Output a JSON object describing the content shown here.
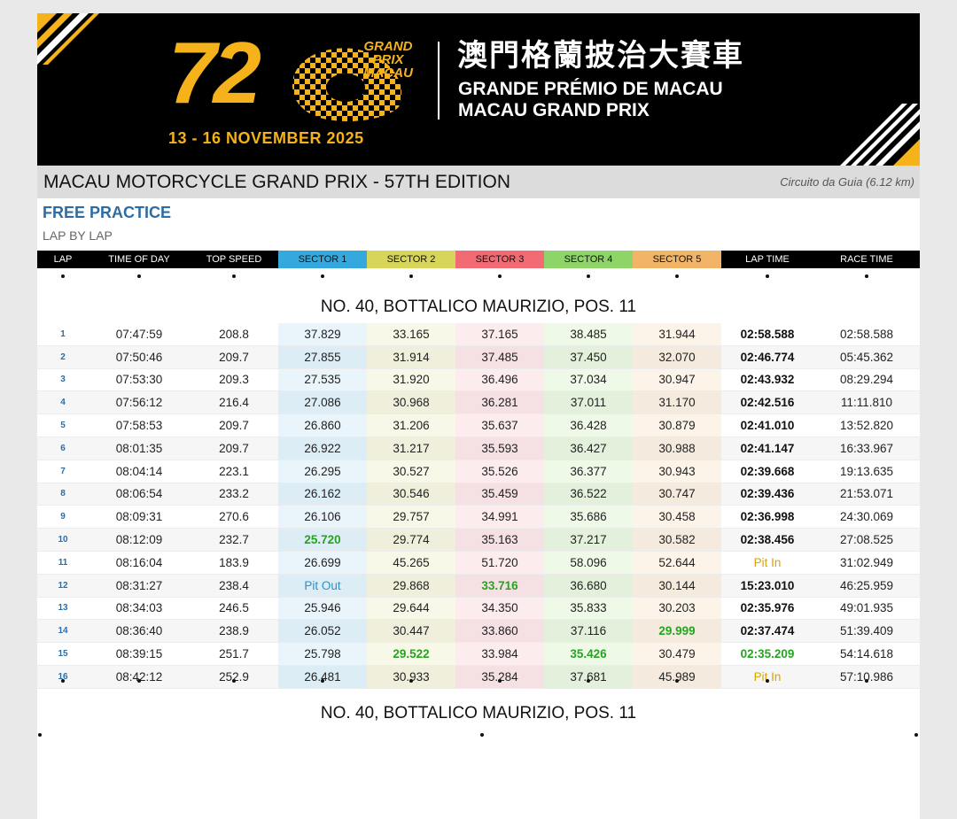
{
  "banner": {
    "edition_number": "72",
    "logo_text": [
      "GRAND",
      "PRIX",
      "MACAU"
    ],
    "title_cn": "澳門格蘭披治大賽車",
    "title_pt": "GRANDE PRÉMIO DE MACAU",
    "title_en": "MACAU GRAND PRIX",
    "dates": "13 - 16 NOVEMBER 2025",
    "brand_color": "#f5b21a"
  },
  "event": {
    "title": "MACAU MOTORCYCLE GRAND PRIX - 57TH EDITION",
    "circuit": "Circuito da Guia (6.12 km)"
  },
  "session": "FREE PRACTICE",
  "report": "LAP BY LAP",
  "columns": [
    "LAP",
    "TIME OF DAY",
    "TOP SPEED",
    "SECTOR 1",
    "SECTOR 2",
    "SECTOR 3",
    "SECTOR 4",
    "SECTOR 5",
    "LAP TIME",
    "RACE TIME"
  ],
  "driver_heading": "NO. 40, BOTTALICO MAURIZIO, POS. 11",
  "driver_heading_repeat": "NO. 40, BOTTALICO MAURIZIO, POS. 11",
  "status_colors": {
    "best": "#27a322",
    "pit_in": "#d9a400",
    "pit_out": "#2e8fc9"
  },
  "laps": [
    {
      "lap": "1",
      "tod": "07:47:59",
      "speed": "208.8",
      "s1": "37.829",
      "s2": "33.165",
      "s3": "37.165",
      "s4": "38.485",
      "s5": "31.944",
      "lap_time": "02:58.588",
      "race_time": "02:58.588"
    },
    {
      "lap": "2",
      "tod": "07:50:46",
      "speed": "209.7",
      "s1": "27.855",
      "s2": "31.914",
      "s3": "37.485",
      "s4": "37.450",
      "s5": "32.070",
      "lap_time": "02:46.774",
      "race_time": "05:45.362"
    },
    {
      "lap": "3",
      "tod": "07:53:30",
      "speed": "209.3",
      "s1": "27.535",
      "s2": "31.920",
      "s3": "36.496",
      "s4": "37.034",
      "s5": "30.947",
      "lap_time": "02:43.932",
      "race_time": "08:29.294"
    },
    {
      "lap": "4",
      "tod": "07:56:12",
      "speed": "216.4",
      "s1": "27.086",
      "s2": "30.968",
      "s3": "36.281",
      "s4": "37.011",
      "s5": "31.170",
      "lap_time": "02:42.516",
      "race_time": "11:11.810"
    },
    {
      "lap": "5",
      "tod": "07:58:53",
      "speed": "209.7",
      "s1": "26.860",
      "s2": "31.206",
      "s3": "35.637",
      "s4": "36.428",
      "s5": "30.879",
      "lap_time": "02:41.010",
      "race_time": "13:52.820"
    },
    {
      "lap": "6",
      "tod": "08:01:35",
      "speed": "209.7",
      "s1": "26.922",
      "s2": "31.217",
      "s3": "35.593",
      "s4": "36.427",
      "s5": "30.988",
      "lap_time": "02:41.147",
      "race_time": "16:33.967"
    },
    {
      "lap": "7",
      "tod": "08:04:14",
      "speed": "223.1",
      "s1": "26.295",
      "s2": "30.527",
      "s3": "35.526",
      "s4": "36.377",
      "s5": "30.943",
      "lap_time": "02:39.668",
      "race_time": "19:13.635"
    },
    {
      "lap": "8",
      "tod": "08:06:54",
      "speed": "233.2",
      "s1": "26.162",
      "s2": "30.546",
      "s3": "35.459",
      "s4": "36.522",
      "s5": "30.747",
      "lap_time": "02:39.436",
      "race_time": "21:53.071"
    },
    {
      "lap": "9",
      "tod": "08:09:31",
      "speed": "270.6",
      "s1": "26.106",
      "s2": "29.757",
      "s3": "34.991",
      "s4": "35.686",
      "s5": "30.458",
      "lap_time": "02:36.998",
      "race_time": "24:30.069"
    },
    {
      "lap": "10",
      "tod": "08:12:09",
      "speed": "232.7",
      "s1": "25.720",
      "s2": "29.774",
      "s3": "35.163",
      "s4": "37.217",
      "s5": "30.582",
      "lap_time": "02:38.456",
      "race_time": "27:08.525",
      "best": [
        "s1"
      ]
    },
    {
      "lap": "11",
      "tod": "08:16:04",
      "speed": "183.9",
      "s1": "26.699",
      "s2": "45.265",
      "s3": "51.720",
      "s4": "58.096",
      "s5": "52.644",
      "lap_time": "Pit In",
      "race_time": "31:02.949",
      "pit_in": true
    },
    {
      "lap": "12",
      "tod": "08:31:27",
      "speed": "238.4",
      "s1": "Pit Out",
      "s2": "29.868",
      "s3": "33.716",
      "s4": "36.680",
      "s5": "30.144",
      "lap_time": "15:23.010",
      "race_time": "46:25.959",
      "best": [
        "s3"
      ],
      "pit_out": true
    },
    {
      "lap": "13",
      "tod": "08:34:03",
      "speed": "246.5",
      "s1": "25.946",
      "s2": "29.644",
      "s3": "34.350",
      "s4": "35.833",
      "s5": "30.203",
      "lap_time": "02:35.976",
      "race_time": "49:01.935"
    },
    {
      "lap": "14",
      "tod": "08:36:40",
      "speed": "238.9",
      "s1": "26.052",
      "s2": "30.447",
      "s3": "33.860",
      "s4": "37.116",
      "s5": "29.999",
      "lap_time": "02:37.474",
      "race_time": "51:39.409",
      "best": [
        "s5"
      ]
    },
    {
      "lap": "15",
      "tod": "08:39:15",
      "speed": "251.7",
      "s1": "25.798",
      "s2": "29.522",
      "s3": "33.984",
      "s4": "35.426",
      "s5": "30.479",
      "lap_time": "02:35.209",
      "race_time": "54:14.618",
      "best": [
        "s2",
        "s4",
        "lap_time"
      ]
    },
    {
      "lap": "16",
      "tod": "08:42:12",
      "speed": "252.9",
      "s1": "26.481",
      "s2": "30.933",
      "s3": "35.284",
      "s4": "37.681",
      "s5": "45.989",
      "lap_time": "Pit In",
      "race_time": "57:10.986",
      "pit_in": true
    }
  ]
}
